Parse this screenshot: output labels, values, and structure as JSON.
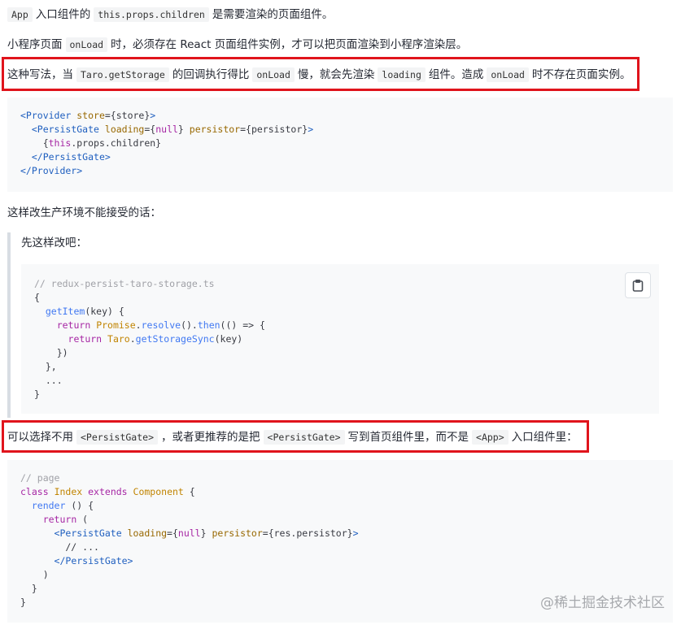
{
  "p1": {
    "c1": "App",
    "t1": "入口组件的",
    "c2": "this.props.children",
    "t2": "是需要渲染的页面组件。"
  },
  "p2": {
    "t1": "小程序页面",
    "c1": "onLoad",
    "t2": "时，必须存在 React 页面组件实例，才可以把页面渲染到小程序渲染层。"
  },
  "p3": {
    "t1": "这种写法，当",
    "c1": "Taro.getStorage",
    "t2": "的回调执行得比",
    "c2": "onLoad",
    "t3": "慢，就会先渲染",
    "c3": "loading",
    "t4": "组件。造成",
    "c4": "onLoad",
    "t5": "时不存在页面实例。"
  },
  "p4": {
    "t1": "这样改生产环境不能接受的话："
  },
  "quote": {
    "text": "先这样改吧："
  },
  "p5": {
    "t1": "可以选择不用",
    "c1": "<PersistGate>",
    "t2": "，或者更推荐的是把",
    "c2": "<PersistGate>",
    "t3": "写到首页组件里，而不是",
    "c3": "<App>",
    "t4": "入口组件里："
  },
  "icons": {
    "copy": "clipboard-icon"
  },
  "watermark": "@稀土掘金技术社区",
  "colors": {
    "highlight": "#e0141c",
    "code_bg": "#f8f9fa",
    "inline_code_bg": "#f3f4f5"
  }
}
